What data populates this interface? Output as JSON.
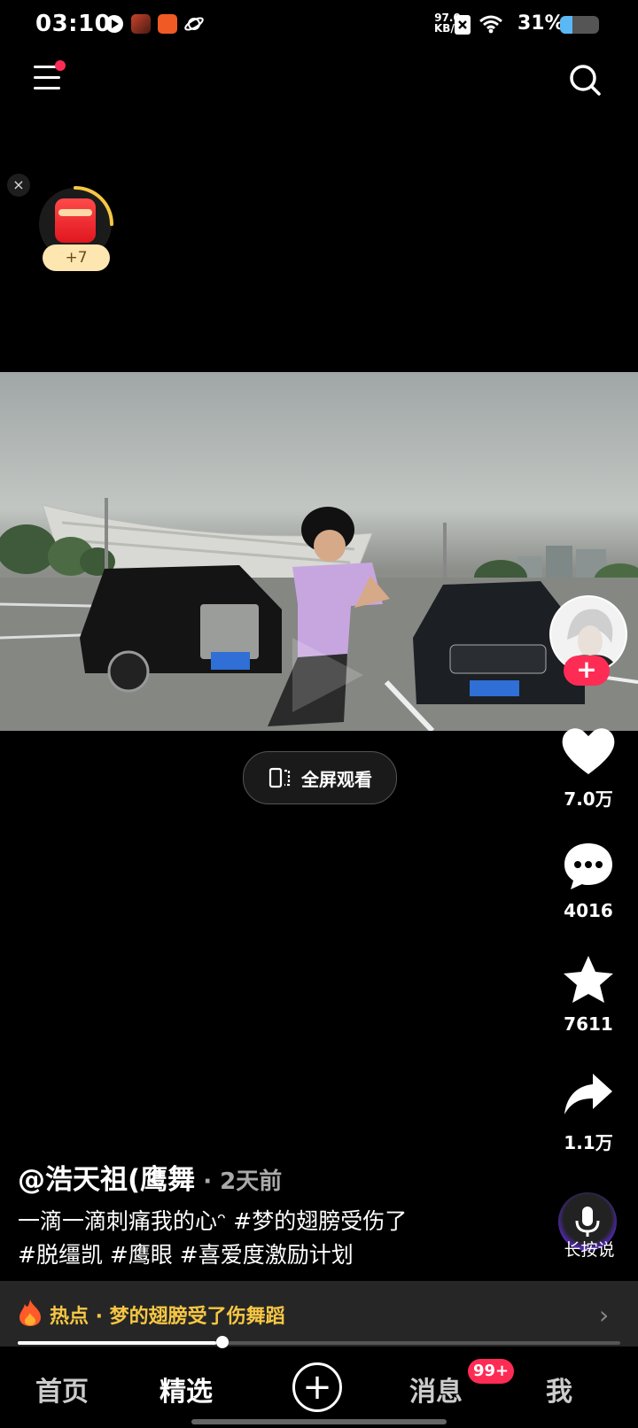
{
  "status_bar": {
    "time": "03:10",
    "net_speed_value": "97.0",
    "net_speed_unit": "KB/s",
    "battery_percent": "31%",
    "battery_level": 0.31,
    "app_icons": [
      "play-icon",
      "game-icon",
      "app-icon",
      "planet-icon"
    ]
  },
  "top_nav": {
    "menu_icon": "menu-icon",
    "search_icon": "search-icon",
    "has_notification_dot": true
  },
  "red_packet": {
    "reward": "+7",
    "close_label": "×",
    "progress": 0.25
  },
  "video": {
    "fullscreen_label": "全屏观看",
    "play_progress": 0.33
  },
  "right_rail": {
    "follow_label": "+",
    "likes": "7.0万",
    "comments": "4016",
    "favorites": "7611",
    "shares": "1.1万",
    "voice_label": "长按说"
  },
  "caption": {
    "author": "@浩天祖(鹰舞",
    "date": " · 2天前",
    "line1": "一滴一滴刺痛我的心ᵔ #梦的翅膀受伤了",
    "line2": "#脱缰凯 #鹰眼 #喜爱度激励计划"
  },
  "hot_banner": {
    "text": "热点 · 梦的翅膀受了伤舞蹈",
    "chevron": "›"
  },
  "bottom_nav": {
    "tabs": [
      {
        "label": "首页",
        "active": false
      },
      {
        "label": "精选",
        "active": true
      },
      {
        "label": "+",
        "active": false
      },
      {
        "label": "消息",
        "active": false,
        "badge": "99+"
      },
      {
        "label": "我",
        "active": false
      }
    ]
  },
  "colors": {
    "accent": "#fe2c55",
    "hot": "#f6c744",
    "battery": "#5ab8f5"
  }
}
